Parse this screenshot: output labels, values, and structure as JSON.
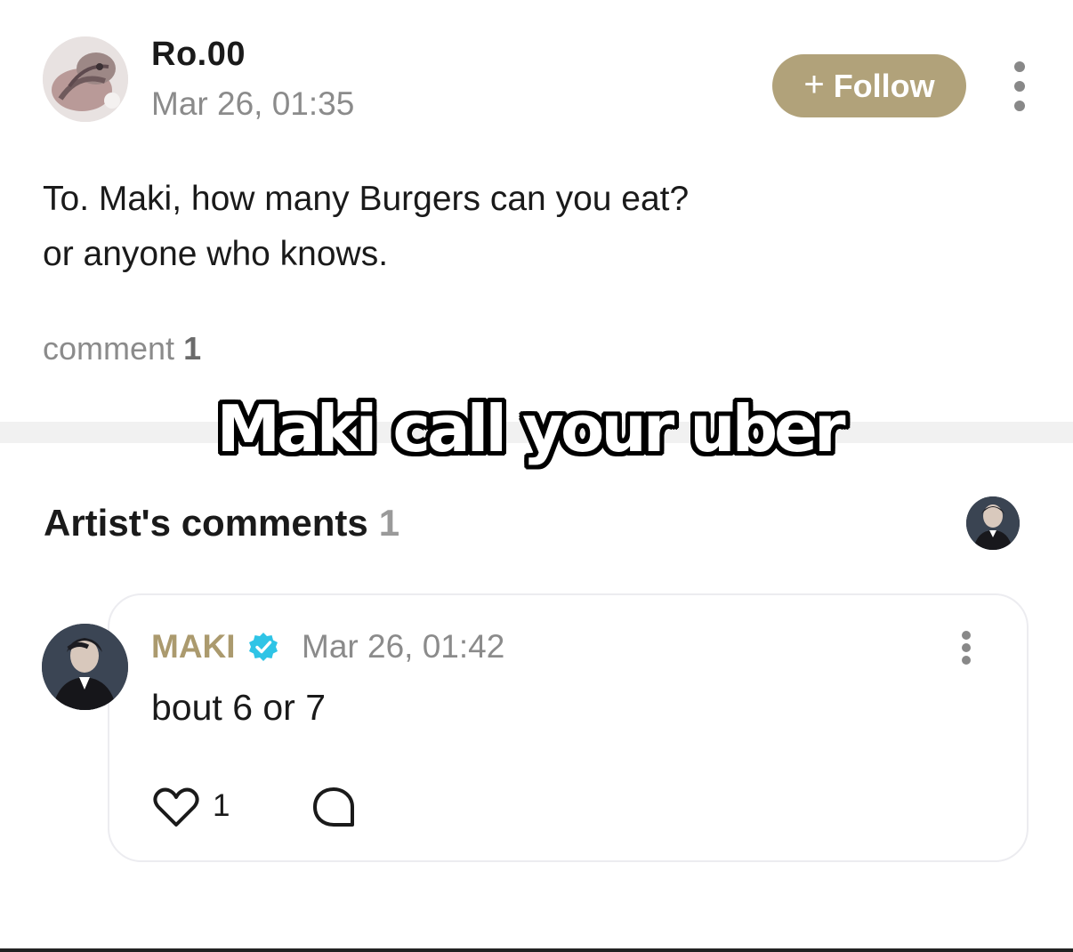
{
  "post": {
    "author": "Ro.00",
    "timestamp": "Mar 26, 01:35",
    "follow_label": "Follow",
    "follow_icon": "+",
    "body_lines": [
      "To. Maki, how many Burgers can you eat?",
      "or anyone who knows."
    ],
    "comment_label": "comment",
    "comment_count": "1"
  },
  "overlay_caption": "Maki call your uber",
  "artist_comments": {
    "title": "Artist's comments",
    "count": "1"
  },
  "comment": {
    "author": "MAKI",
    "verified": true,
    "timestamp": "Mar 26, 01:42",
    "text": "bout 6 or 7",
    "like_count": "1"
  },
  "colors": {
    "accent_gold": "#b1a27a",
    "artist_name": "#ab9a6e",
    "verified_badge": "#2ec4e6",
    "muted_text": "#8b8b8b"
  },
  "icons": {
    "more": "kebab-vertical-icon",
    "like": "heart-outline-icon",
    "reply": "speech-bubble-icon",
    "verified": "verified-badge-icon"
  }
}
